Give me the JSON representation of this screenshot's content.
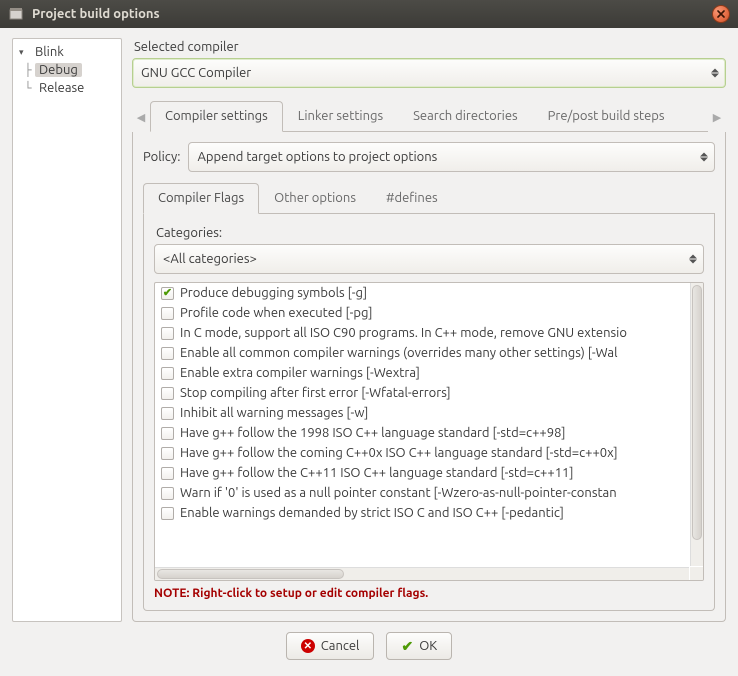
{
  "window": {
    "title": "Project build options"
  },
  "tree": {
    "root": "Blink",
    "children": [
      "Debug",
      "Release"
    ],
    "selected": "Debug"
  },
  "selected_compiler_label": "Selected compiler",
  "selected_compiler_value": "GNU GCC Compiler",
  "main_tabs": [
    "Compiler settings",
    "Linker settings",
    "Search directories",
    "Pre/post build steps"
  ],
  "main_tab_active": 0,
  "policy_label": "Policy:",
  "policy_value": "Append target options to project options",
  "sub_tabs": [
    "Compiler Flags",
    "Other options",
    "#defines"
  ],
  "sub_tab_active": 0,
  "categories_label": "Categories:",
  "categories_value": "<All categories>",
  "flags": [
    {
      "checked": true,
      "text": "Produce debugging symbols  [-g]"
    },
    {
      "checked": false,
      "text": "Profile code when executed  [-pg]"
    },
    {
      "checked": false,
      "text": "In C mode, support all ISO C90 programs. In C++ mode, remove GNU extensio"
    },
    {
      "checked": false,
      "text": "Enable all common compiler warnings (overrides many other settings)  [-Wal"
    },
    {
      "checked": false,
      "text": "Enable extra compiler warnings  [-Wextra]"
    },
    {
      "checked": false,
      "text": "Stop compiling after first error  [-Wfatal-errors]"
    },
    {
      "checked": false,
      "text": "Inhibit all warning messages  [-w]"
    },
    {
      "checked": false,
      "text": "Have g++ follow the 1998 ISO C++ language standard  [-std=c++98]"
    },
    {
      "checked": false,
      "text": "Have g++ follow the coming C++0x ISO C++ language standard  [-std=c++0x]"
    },
    {
      "checked": false,
      "text": "Have g++ follow the C++11 ISO C++ language standard  [-std=c++11]"
    },
    {
      "checked": false,
      "text": "Warn if '0' is used as a null pointer constant  [-Wzero-as-null-pointer-constan"
    },
    {
      "checked": false,
      "text": "Enable warnings demanded by strict ISO C and ISO C++  [-pedantic]"
    }
  ],
  "note": "NOTE: Right-click to setup or edit compiler flags.",
  "buttons": {
    "cancel": "Cancel",
    "ok": "OK"
  }
}
